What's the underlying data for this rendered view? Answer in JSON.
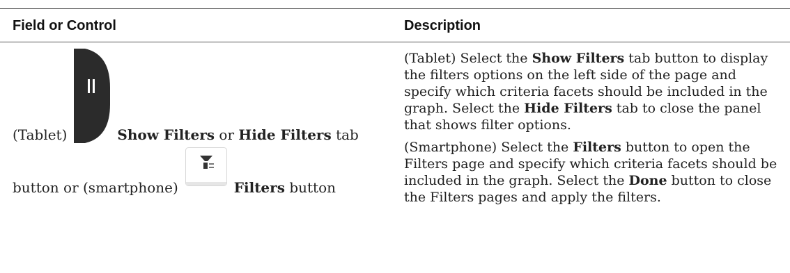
{
  "header": {
    "field_col": "Field or Control",
    "desc_col": "Description"
  },
  "field": {
    "part1": "(Tablet)",
    "show_filters": "Show Filters",
    "or": "or",
    "hide_filters": "Hide Filters",
    "tab": "tab",
    "part2": "button or (smartphone)",
    "filters": "Filters",
    "button": "button",
    "icons": [
      "tab-handle-icon",
      "filter-funnel-icon"
    ]
  },
  "description": {
    "p1": [
      "(Tablet) Select the ",
      "Show Filters",
      " tab button to display the filters options on the left side of the page and specify which criteria facets should be included in the graph. Select the ",
      "Hide Filters",
      " tab to close the panel that shows filter options."
    ],
    "p2": [
      "(Smartphone) Select the ",
      "Filters",
      " button to open the Filters page and specify which criteria facets should be included in the graph. Select the ",
      "Done",
      " button to close the Filters pages and apply the filters."
    ]
  }
}
